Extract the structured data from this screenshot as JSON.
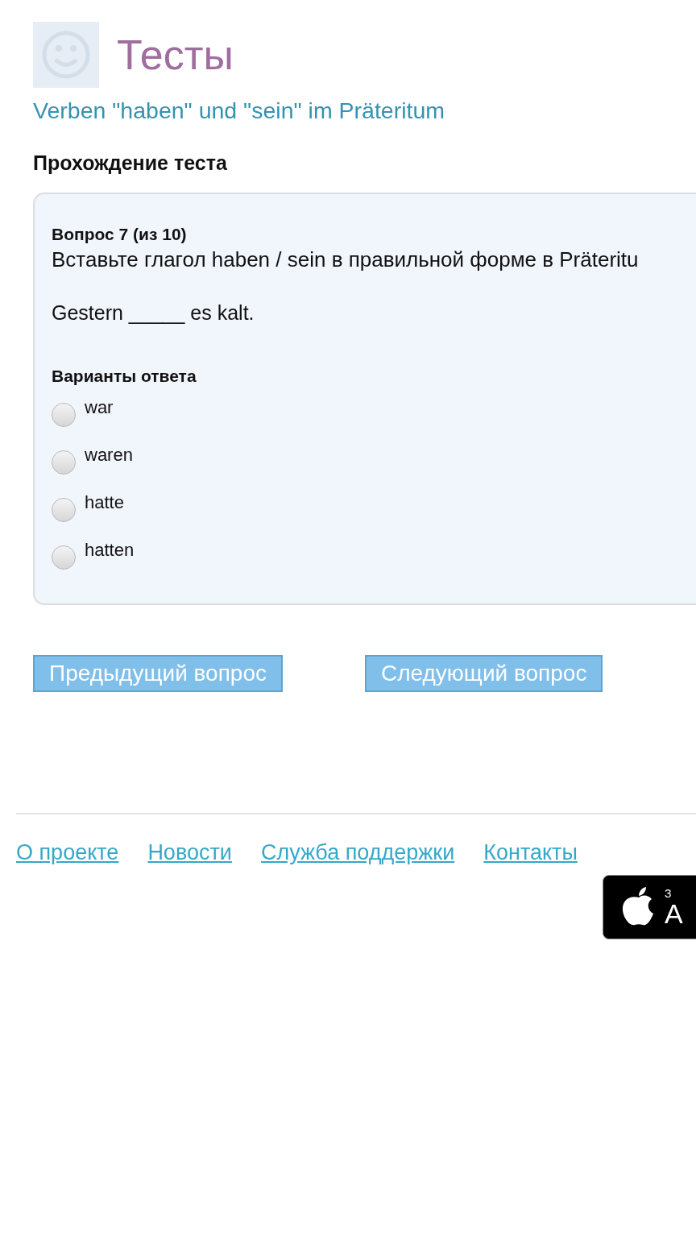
{
  "header": {
    "title": "Тесты",
    "subtitle": "Verben \"haben\" und \"sein\" im Präteritum"
  },
  "section_title": "Прохождение теста",
  "question": {
    "number": "Вопрос 7 (из 10)",
    "instruction": "Вставьте глагол haben / sein в правильной форме в Präteritu",
    "sentence": "Gestern _____ es kalt.",
    "options_title": "Варианты ответа",
    "options": [
      {
        "label": "war",
        "selected": false
      },
      {
        "label": "waren",
        "selected": false
      },
      {
        "label": "hatte",
        "selected": false
      },
      {
        "label": "hatten",
        "selected": false
      }
    ]
  },
  "buttons": [
    "Предыдущий вопрос",
    "Следующий вопрос"
  ],
  "footer_links": [
    "О проекте",
    "Новости",
    "Служба поддержки",
    "Контакты"
  ],
  "store_badge": {
    "line_1": "З",
    "line_2": "A"
  }
}
